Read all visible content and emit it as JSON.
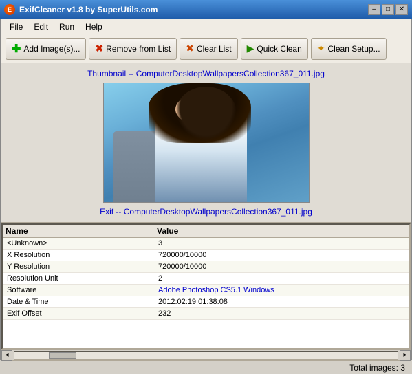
{
  "titlebar": {
    "title": "ExifCleaner v1.8 by SuperUtils.com",
    "icon": "E",
    "controls": {
      "minimize": "–",
      "maximize": "□",
      "close": "✕"
    }
  },
  "menubar": {
    "items": [
      "File",
      "Edit",
      "Run",
      "Help"
    ]
  },
  "toolbar": {
    "buttons": [
      {
        "id": "add-images",
        "label": "Add Image(s)...",
        "icon": "+"
      },
      {
        "id": "remove-from-list",
        "label": "Remove from List",
        "icon": "✕"
      },
      {
        "id": "clear-list",
        "label": "Clear List",
        "icon": "✕"
      },
      {
        "id": "quick-clean",
        "label": "Quick Clean",
        "icon": "▶"
      },
      {
        "id": "clean-setup",
        "label": "Clean Setup...",
        "icon": "✦"
      }
    ]
  },
  "image_section": {
    "thumbnail_label": "Thumbnail -- ComputerDesktopWallpapersCollection367_011.jpg",
    "exif_label": "Exif -- ComputerDesktopWallpapersCollection367_011.jpg"
  },
  "table": {
    "headers": {
      "name": "Name",
      "value": "Value"
    },
    "rows": [
      {
        "name": "<Unknown>",
        "value": "3",
        "value_class": ""
      },
      {
        "name": "X Resolution",
        "value": "720000/10000",
        "value_class": ""
      },
      {
        "name": "Y Resolution",
        "value": "720000/10000",
        "value_class": ""
      },
      {
        "name": "Resolution Unit",
        "value": "2",
        "value_class": ""
      },
      {
        "name": "Software",
        "value": "Adobe Photoshop CS5.1 Windows",
        "value_class": "blue"
      },
      {
        "name": "Date & Time",
        "value": "2012:02:19 01:38:08",
        "value_class": ""
      },
      {
        "name": "Exif Offset",
        "value": "232",
        "value_class": ""
      }
    ]
  },
  "statusbar": {
    "label": "Total images:",
    "count": "3",
    "full": "Total images: 3"
  }
}
